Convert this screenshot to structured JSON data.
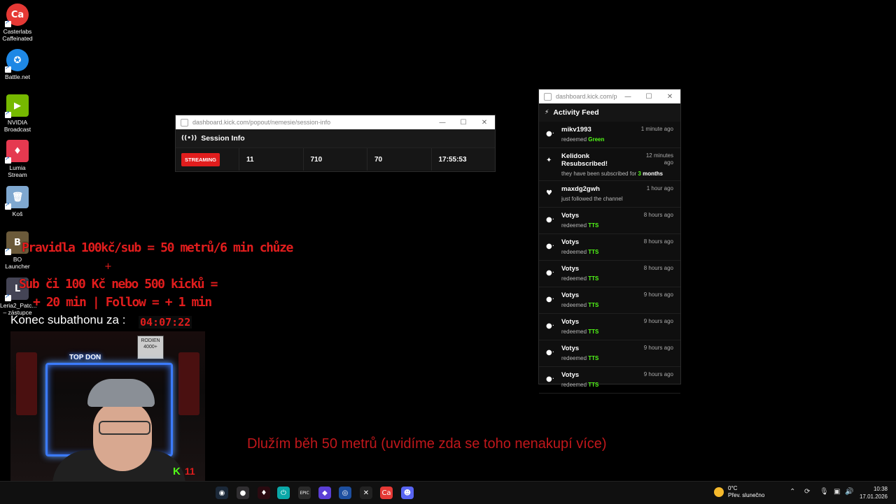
{
  "desktop_icons": [
    {
      "name": "casterlabs",
      "label_lines": [
        "Casterlabs",
        "Caffeinated"
      ],
      "glyph": "Ca",
      "color": "#e53935"
    },
    {
      "name": "battlenet",
      "label_lines": [
        "Battle.net"
      ],
      "glyph": "✪",
      "color": "#1e88e5"
    },
    {
      "name": "nvidia-broadcast",
      "label_lines": [
        "NVIDIA",
        "Broadcast"
      ],
      "glyph": "▶",
      "color": "#76b900"
    },
    {
      "name": "lumia-stream",
      "label_lines": [
        "Lumia",
        "Stream"
      ],
      "glyph": "♦",
      "color": "#e53950"
    },
    {
      "name": "recycle-bin",
      "label_lines": [
        "Koš"
      ],
      "glyph": "🗑",
      "color": "#7fa8d0"
    },
    {
      "name": "bo-launcher",
      "label_lines": [
        "BO Launcher"
      ],
      "glyph": "B",
      "color": "#6b5a3a"
    },
    {
      "name": "leria-patcher",
      "label_lines": [
        "Leria2_Patc...",
        "– zástupce"
      ],
      "glyph": "L",
      "color": "#445"
    }
  ],
  "overlay": {
    "rules_line1": "Pravidla 100kč/sub = 50 metrů/6 min chůze",
    "plus": "+",
    "rules_line2": "Sub či 100 Kč nebo 500 kicků =",
    "rules_line3": "+ 20 min | Follow = + 1 min",
    "subathon_label": "Konec subathonu za :",
    "subathon_timer": "04:07:22",
    "debt_text": "Dlužím běh 50 metrů (uvidíme zda se toho nenakupí více)",
    "kick_count": "11",
    "topdon": "TOP DON",
    "sign_text": "RODIEN 4000+"
  },
  "session_window": {
    "url": "dashboard.kick.com/popout/nemesie/session-info",
    "title": "Session Info",
    "status": "STREAMING",
    "stats": [
      "11",
      "710",
      "70",
      "17:55:53"
    ]
  },
  "activity_window": {
    "url": "dashboard.kick.com/po...",
    "title": "Activity Feed",
    "items": [
      {
        "icon": "redeem",
        "user": "mikv1993",
        "action": "redeemed",
        "highlight": "Green",
        "suffix": "",
        "time": "1 minute ago"
      },
      {
        "icon": "sparkle",
        "user": "Kelidonk Resubscribed!",
        "action": "they have been subscribed for",
        "highlight": "3",
        "suffix": "months",
        "time": "12 minutes ago"
      },
      {
        "icon": "heart",
        "user": "maxdg2gwh",
        "action": "just followed the channel",
        "highlight": "",
        "suffix": "",
        "time": "1 hour ago"
      },
      {
        "icon": "redeem",
        "user": "Votys",
        "action": "redeemed",
        "highlight": "TTS",
        "suffix": "",
        "time": "8 hours ago"
      },
      {
        "icon": "redeem",
        "user": "Votys",
        "action": "redeemed",
        "highlight": "TTS",
        "suffix": "",
        "time": "8 hours ago"
      },
      {
        "icon": "redeem",
        "user": "Votys",
        "action": "redeemed",
        "highlight": "TTS",
        "suffix": "",
        "time": "8 hours ago"
      },
      {
        "icon": "redeem",
        "user": "Votys",
        "action": "redeemed",
        "highlight": "TTS",
        "suffix": "",
        "time": "9 hours ago"
      },
      {
        "icon": "redeem",
        "user": "Votys",
        "action": "redeemed",
        "highlight": "TTS",
        "suffix": "",
        "time": "9 hours ago"
      },
      {
        "icon": "redeem",
        "user": "Votys",
        "action": "redeemed",
        "highlight": "TTS",
        "suffix": "",
        "time": "9 hours ago"
      },
      {
        "icon": "redeem",
        "user": "Votys",
        "action": "redeemed",
        "highlight": "TTS",
        "suffix": "",
        "time": "9 hours ago"
      }
    ]
  },
  "taskbar": {
    "apps": [
      {
        "name": "steam",
        "glyph": "◉",
        "color": "#1b2838"
      },
      {
        "name": "obs",
        "glyph": "●",
        "color": "#302e31"
      },
      {
        "name": "lumia",
        "glyph": "♦",
        "color": "#2a0a10"
      },
      {
        "name": "power",
        "glyph": "⏻",
        "color": "#0aa8a8"
      },
      {
        "name": "epic",
        "glyph": "EPIC",
        "color": "#2a2a2a"
      },
      {
        "name": "diamond",
        "glyph": "◆",
        "color": "#5b3fd6"
      },
      {
        "name": "uplay",
        "glyph": "◎",
        "color": "#1d4fa0"
      },
      {
        "name": "tool",
        "glyph": "✕",
        "color": "#222"
      },
      {
        "name": "casterlabs",
        "glyph": "Ca",
        "color": "#e53935"
      },
      {
        "name": "discord",
        "glyph": "☻",
        "color": "#5865f2"
      }
    ],
    "weather_temp": "0°C",
    "weather_desc": "Přev. slunečno",
    "time": "10:38",
    "date": "17.01.2026"
  }
}
